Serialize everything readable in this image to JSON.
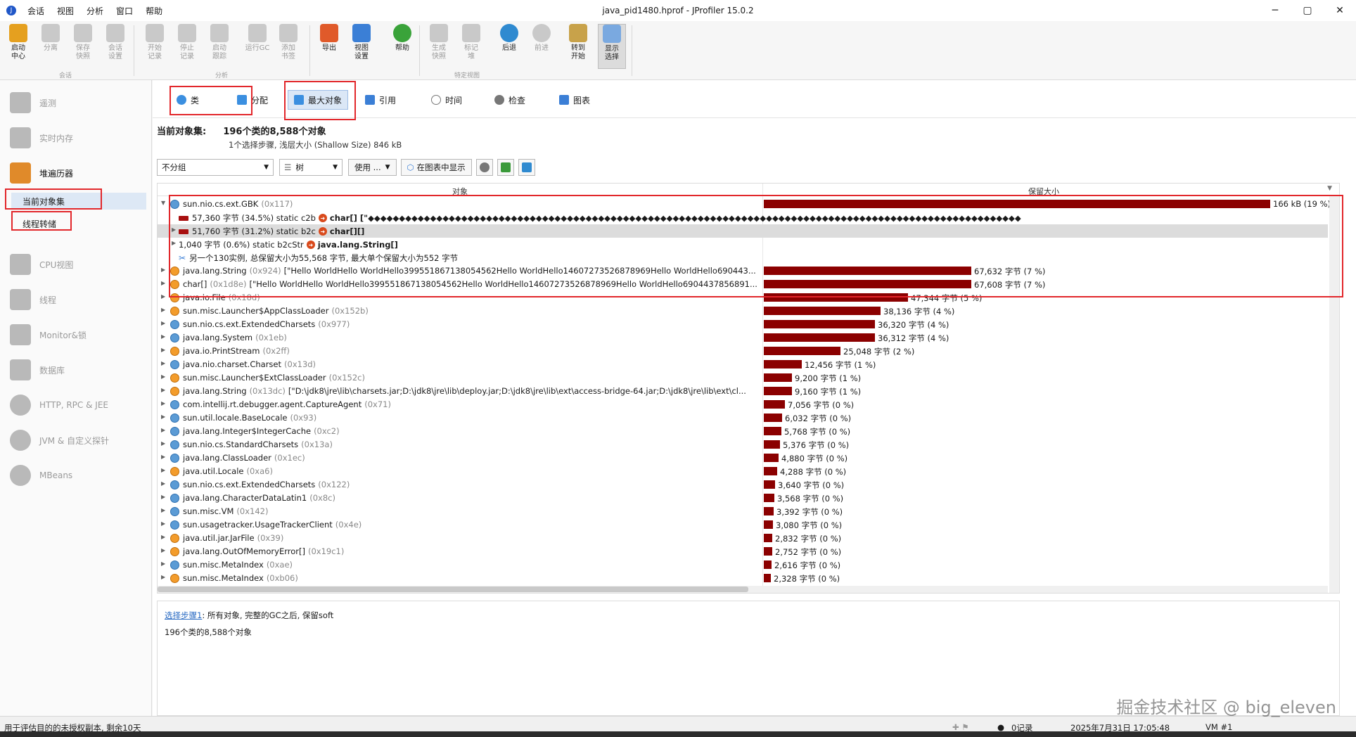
{
  "titlebar": {
    "title": "java_pid1480.hprof - JProfiler 15.0.2",
    "menu": [
      "会话",
      "视图",
      "分析",
      "窗口",
      "帮助"
    ],
    "min": "─",
    "max": "▢",
    "close": "✕"
  },
  "toolbar": {
    "buttons": [
      {
        "label": "启动\n中心",
        "icon": "start-center-icon"
      },
      {
        "label": "分离",
        "icon": "detach-icon"
      },
      {
        "label": "保存\n快照",
        "icon": "save-snapshot-icon"
      },
      {
        "label": "会话\n设置",
        "icon": "session-settings-icon"
      },
      {
        "label": "开始\n记录",
        "icon": "start-recording-icon"
      },
      {
        "label": "停止\n记录",
        "icon": "stop-recording-icon"
      },
      {
        "label": "启动\n跟踪",
        "icon": "start-tracking-icon"
      },
      {
        "label": "运行GC",
        "icon": "run-gc-icon"
      },
      {
        "label": "添加\n书签",
        "icon": "add-bookmark-icon"
      },
      {
        "label": "导出",
        "icon": "export-icon"
      },
      {
        "label": "视图\n设置",
        "icon": "view-settings-icon"
      },
      {
        "label": "帮助",
        "icon": "help-icon"
      },
      {
        "label": "生成\n快照",
        "icon": "create-snapshot-icon"
      },
      {
        "label": "标记\n堆",
        "icon": "mark-heap-icon"
      },
      {
        "label": "后退",
        "icon": "back-icon"
      },
      {
        "label": "前进",
        "icon": "forward-icon"
      },
      {
        "label": "转到\n开始",
        "icon": "goto-start-icon"
      },
      {
        "label": "显示\n选择",
        "icon": "show-selection-icon"
      }
    ],
    "groups": [
      "会话",
      "分析",
      "特定视图"
    ]
  },
  "sidebar": {
    "items": [
      {
        "label": "遥测"
      },
      {
        "label": "实时内存"
      },
      {
        "label": "堆遍历器"
      },
      {
        "label": "CPU视图"
      },
      {
        "label": "线程"
      },
      {
        "label": "Monitor&锁"
      },
      {
        "label": "数据库"
      },
      {
        "label": "HTTP, RPC & JEE"
      },
      {
        "label": "JVM & 自定义探针"
      },
      {
        "label": "MBeans"
      }
    ],
    "subitems": [
      "当前对象集",
      "线程转储"
    ]
  },
  "viewtabs": [
    "类",
    "分配",
    "最大对象",
    "引用",
    "时间",
    "检查",
    "图表"
  ],
  "header": {
    "label": "当前对象集:",
    "summary": "196个类的8,588个对象",
    "sub": "1个选择步骤, 浅层大小 (Shallow Size) 846 kB"
  },
  "controls": {
    "grouping": "不分组",
    "view": "树",
    "use": "使用 ...",
    "show_in_graph": "在图表中显示"
  },
  "table": {
    "col_object": "对象",
    "col_retained": "保留大小",
    "rows": [
      {
        "exp": "▼",
        "indent": 0,
        "icon": "blue",
        "name": "sun.nio.cs.ext.GBK",
        "addr": "(0x117)",
        "size": "166 kB (19 %)",
        "bar": 1.0
      },
      {
        "exp": "",
        "indent": 1,
        "icon": "red",
        "name": "57,360 字节 (34.5%) static c2b",
        "ref": "char[] [\"◆◆◆◆◆◆◆◆◆◆◆◆◆◆◆◆◆◆◆◆◆◆◆◆◆◆◆◆◆◆◆◆◆◆◆◆◆◆◆◆◆◆◆◆◆◆◆◆◆◆◆◆◆◆◆◆◆◆◆◆◆◆◆◆◆◆◆◆◆◆◆◆◆◆◆◆◆◆◆◆◆◆◆◆◆◆◆◆◆◆◆◆◆◆◆◆◆◆◆◆◆◆◆◆◆",
        "size": "",
        "bar": 0
      },
      {
        "exp": "▶",
        "indent": 1,
        "icon": "red",
        "name": "51,760 字节 (31.2%) static b2c",
        "ref": "char[][]",
        "size": "",
        "bar": 0,
        "hl": true
      },
      {
        "exp": "▶",
        "indent": 1,
        "icon": "none",
        "name": "1,040 字节 (0.6%) static b2cStr",
        "ref": "java.lang.String[]",
        "size": "",
        "bar": 0
      },
      {
        "exp": "",
        "indent": 1,
        "icon": "scissor",
        "name": "另一个130实例, 总保留大小为55,568 字节, 最大单个保留大小为552 字节",
        "size": "",
        "bar": 0
      },
      {
        "exp": "▶",
        "indent": 0,
        "icon": "orange",
        "name": "java.lang.String",
        "addr": "(0x924)",
        "extra": "[\"Hello WorldHello WorldHello399551867138054562Hello WorldHello14607273526878969Hello WorldHello690443...",
        "size": "67,632 字节 (7 %)",
        "bar": 0.41
      },
      {
        "exp": "▶",
        "indent": 0,
        "icon": "orange",
        "name": "char[]",
        "addr": "(0x1d8e)",
        "extra": "[\"Hello WorldHello WorldHello399551867138054562Hello WorldHello14607273526878969Hello WorldHello6904437856891...",
        "size": "67,608 字节 (7 %)",
        "bar": 0.41
      },
      {
        "exp": "▶",
        "indent": 0,
        "icon": "orange",
        "name": "java.io.File",
        "addr": "(0x18d)",
        "size": "47,344 字节 (5 %)",
        "bar": 0.285
      },
      {
        "exp": "▶",
        "indent": 0,
        "icon": "orange",
        "name": "sun.misc.Launcher$AppClassLoader",
        "addr": "(0x152b)",
        "size": "38,136 字节 (4 %)",
        "bar": 0.23
      },
      {
        "exp": "▶",
        "indent": 0,
        "icon": "blue",
        "name": "sun.nio.cs.ext.ExtendedCharsets",
        "addr": "(0x977)",
        "size": "36,320 字节 (4 %)",
        "bar": 0.219
      },
      {
        "exp": "▶",
        "indent": 0,
        "icon": "blue",
        "name": "java.lang.System",
        "addr": "(0x1eb)",
        "size": "36,312 字节 (4 %)",
        "bar": 0.219
      },
      {
        "exp": "▶",
        "indent": 0,
        "icon": "orange",
        "name": "java.io.PrintStream",
        "addr": "(0x2ff)",
        "size": "25,048 字节 (2 %)",
        "bar": 0.151
      },
      {
        "exp": "▶",
        "indent": 0,
        "icon": "blue",
        "name": "java.nio.charset.Charset",
        "addr": "(0x13d)",
        "size": "12,456 字节 (1 %)",
        "bar": 0.075
      },
      {
        "exp": "▶",
        "indent": 0,
        "icon": "orange",
        "name": "sun.misc.Launcher$ExtClassLoader",
        "addr": "(0x152c)",
        "size": "9,200 字节 (1 %)",
        "bar": 0.055
      },
      {
        "exp": "▶",
        "indent": 0,
        "icon": "orange",
        "name": "java.lang.String",
        "addr": "(0x13dc)",
        "extra": "[\"D:\\jdk8\\jre\\lib\\charsets.jar;D:\\jdk8\\jre\\lib\\deploy.jar;D:\\jdk8\\jre\\lib\\ext\\access-bridge-64.jar;D:\\jdk8\\jre\\lib\\ext\\cl...",
        "size": "9,160 字节 (1 %)",
        "bar": 0.055
      },
      {
        "exp": "▶",
        "indent": 0,
        "icon": "blue",
        "name": "com.intellij.rt.debugger.agent.CaptureAgent",
        "addr": "(0x71)",
        "size": "7,056 字节 (0 %)",
        "bar": 0.042
      },
      {
        "exp": "▶",
        "indent": 0,
        "icon": "blue",
        "name": "sun.util.locale.BaseLocale",
        "addr": "(0x93)",
        "size": "6,032 字节 (0 %)",
        "bar": 0.036
      },
      {
        "exp": "▶",
        "indent": 0,
        "icon": "blue",
        "name": "java.lang.Integer$IntegerCache",
        "addr": "(0xc2)",
        "size": "5,768 字节 (0 %)",
        "bar": 0.035
      },
      {
        "exp": "▶",
        "indent": 0,
        "icon": "blue",
        "name": "sun.nio.cs.StandardCharsets",
        "addr": "(0x13a)",
        "size": "5,376 字节 (0 %)",
        "bar": 0.032
      },
      {
        "exp": "▶",
        "indent": 0,
        "icon": "blue",
        "name": "java.lang.ClassLoader",
        "addr": "(0x1ec)",
        "size": "4,880 字节 (0 %)",
        "bar": 0.029
      },
      {
        "exp": "▶",
        "indent": 0,
        "icon": "orange",
        "name": "java.util.Locale",
        "addr": "(0xa6)",
        "size": "4,288 字节 (0 %)",
        "bar": 0.026
      },
      {
        "exp": "▶",
        "indent": 0,
        "icon": "blue",
        "name": "sun.nio.cs.ext.ExtendedCharsets",
        "addr": "(0x122)",
        "size": "3,640 字节 (0 %)",
        "bar": 0.022
      },
      {
        "exp": "▶",
        "indent": 0,
        "icon": "blue",
        "name": "java.lang.CharacterDataLatin1",
        "addr": "(0x8c)",
        "size": "3,568 字节 (0 %)",
        "bar": 0.021
      },
      {
        "exp": "▶",
        "indent": 0,
        "icon": "blue",
        "name": "sun.misc.VM",
        "addr": "(0x142)",
        "size": "3,392 字节 (0 %)",
        "bar": 0.02
      },
      {
        "exp": "▶",
        "indent": 0,
        "icon": "blue",
        "name": "sun.usagetracker.UsageTrackerClient",
        "addr": "(0x4e)",
        "size": "3,080 字节 (0 %)",
        "bar": 0.018
      },
      {
        "exp": "▶",
        "indent": 0,
        "icon": "orange",
        "name": "java.util.jar.JarFile",
        "addr": "(0x39)",
        "size": "2,832 字节 (0 %)",
        "bar": 0.017
      },
      {
        "exp": "▶",
        "indent": 0,
        "icon": "orange",
        "name": "java.lang.OutOfMemoryError[]",
        "addr": "(0x19c1)",
        "size": "2,752 字节 (0 %)",
        "bar": 0.016
      },
      {
        "exp": "▶",
        "indent": 0,
        "icon": "blue",
        "name": "sun.misc.MetaIndex",
        "addr": "(0xae)",
        "size": "2,616 字节 (0 %)",
        "bar": 0.015
      },
      {
        "exp": "▶",
        "indent": 0,
        "icon": "orange",
        "name": "sun.misc.MetaIndex",
        "addr": "(0xb06)",
        "size": "2,328 字节 (0 %)",
        "bar": 0.014
      }
    ]
  },
  "bottompanel": {
    "step_link": "选择步骤1",
    "step_text": ": 所有对象, 完整的GC之后, 保留soft",
    "summary": "196个类的8,588个对象"
  },
  "statusbar": {
    "license": "用于评估目的的未授权副本, 剩余10天",
    "records": "0记录",
    "datetime": "2025年7月31日 17:05:48",
    "vm": "VM #1"
  },
  "watermark": "掘金技术社区 @ big_eleven",
  "colors": {
    "bar": "#8b0000",
    "highlight_box": "#e2272b",
    "accent": "#2057c8"
  }
}
